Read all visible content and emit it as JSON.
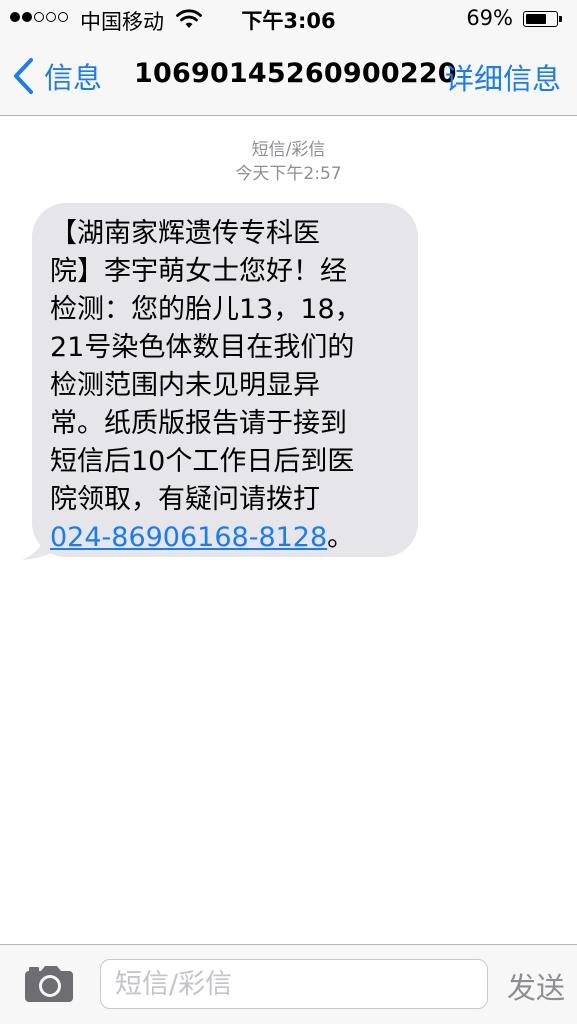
{
  "status_bar": {
    "signal_bars_filled": 2,
    "signal_bars_total": 5,
    "carrier": "中国移动",
    "time": "下午3:06",
    "battery_percent_text": "69%",
    "battery_level": 0.69
  },
  "nav": {
    "back_label": "信息",
    "title": "10690145260900220",
    "details_label": "详细信息"
  },
  "conversation": {
    "message_type": "短信/彩信",
    "timestamp": "今天下午2:57",
    "message_text": "【湖南家辉遗传专科医\n院】李宇萌女士您好！经\n检测：您的胎儿13，18，\n21号染色体数目在我们的\n检测范围内未见明显异\n常。纸质版报告请于接到\n短信后10个工作日后到医\n院领取，有疑问请拨打\n",
    "phone_link": "024-86906168-8128",
    "message_end": "。"
  },
  "input_bar": {
    "placeholder": "短信/彩信",
    "send_label": "发送"
  },
  "colors": {
    "accent": "#1a7cf5",
    "bubble": "#e5e5ea",
    "meta_gray": "#8e8e93"
  }
}
